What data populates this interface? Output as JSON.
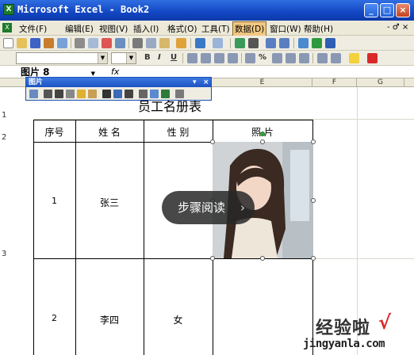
{
  "window": {
    "title": "Microsoft Excel - Book2",
    "app_icon": "X",
    "buttons": [
      "minimize",
      "maximize",
      "close"
    ]
  },
  "menubar": {
    "items": [
      {
        "label": "文件(F)",
        "active": false
      },
      {
        "label": "编辑(E)",
        "active": false
      },
      {
        "label": "视图(V)",
        "active": false
      },
      {
        "label": "插入(I)",
        "active": false
      },
      {
        "label": "格式(O)",
        "active": false
      },
      {
        "label": "工具(T)",
        "active": false
      },
      {
        "label": "数据(D)",
        "active": true
      },
      {
        "label": "窗口(W)",
        "active": false
      },
      {
        "label": "帮助(H)",
        "active": false
      }
    ],
    "right_controls": "- ♂ ×"
  },
  "format_toolbar": {
    "bold": "B",
    "italic": "I",
    "underline": "U",
    "percent": "%"
  },
  "formula_bar": {
    "name_box": "图片 8",
    "fx": "fx"
  },
  "column_headers": [
    "E",
    "F",
    "G"
  ],
  "row_headers": [
    "1",
    "2",
    "3"
  ],
  "picture_toolbar": {
    "title": "图片"
  },
  "sheet": {
    "title": "员工名册表",
    "headers": [
      "序号",
      "姓 名",
      "性 别",
      "照 片"
    ],
    "rows": [
      {
        "index": "1",
        "name": "张三",
        "gender": ""
      },
      {
        "index": "2",
        "name": "李四",
        "gender": "女"
      }
    ]
  },
  "overlay": {
    "label": "步骤阅读",
    "chevron": "›"
  },
  "watermark": {
    "brand": "经验啦",
    "check": "√",
    "url": "jingyanla.com"
  },
  "colors": {
    "titlebar": "#1346c4",
    "menu_active": "#f1c782",
    "watermark_check": "#d82a2a"
  },
  "icons": [
    "app-excel-icon",
    "minimize-icon",
    "maximize-icon",
    "close-icon",
    "chevron-right-icon",
    "fx-icon"
  ]
}
